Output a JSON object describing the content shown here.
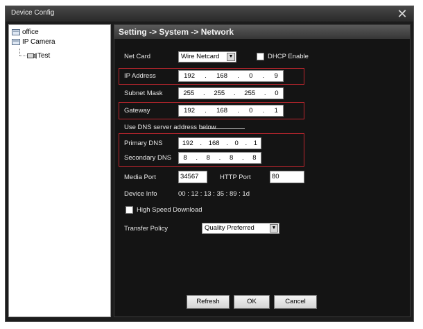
{
  "window": {
    "title": "Device Config"
  },
  "tree": {
    "items": [
      "office",
      "IP Camera",
      "Test"
    ]
  },
  "panel": {
    "breadcrumb": "Setting -> System -> Network",
    "net_card_label": "Net Card",
    "net_card_value": "Wire Netcard",
    "dhcp_label": "DHCP Enable",
    "ip_label": "IP Address",
    "ip": [
      "192",
      "168",
      "0",
      "9"
    ],
    "subnet_label": "Subnet Mask",
    "subnet": [
      "255",
      "255",
      "255",
      "0"
    ],
    "gateway_label": "Gateway",
    "gateway": [
      "192",
      "168",
      "0",
      "1"
    ],
    "dns_note": "Use DNS server address below",
    "primary_dns_label": "Primary DNS",
    "primary_dns": [
      "192",
      "168",
      "0",
      "1"
    ],
    "secondary_dns_label": "Secondary DNS",
    "secondary_dns": [
      "8",
      "8",
      "8",
      "8"
    ],
    "media_port_label": "Media Port",
    "media_port_value": "34567",
    "http_port_label": "HTTP Port",
    "http_port_value": "80",
    "device_info_label": "Device Info",
    "device_info_value": "00 :  12 :  13 :  35 :  89 :  1d",
    "high_speed_label": "High Speed Download",
    "transfer_policy_label": "Transfer Policy",
    "transfer_policy_value": "Quality Preferred"
  },
  "buttons": {
    "refresh": "Refresh",
    "ok": "OK",
    "cancel": "Cancel"
  },
  "colors": {
    "highlight": "#c0262e",
    "panel_bg": "#141414"
  }
}
